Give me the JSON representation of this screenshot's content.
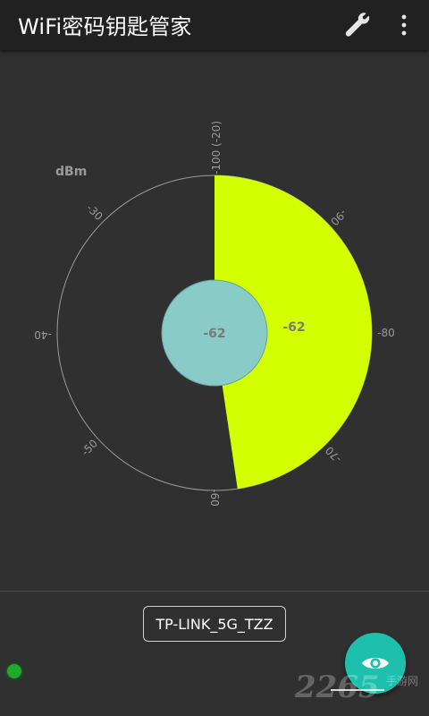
{
  "app": {
    "title": "WiFi密码钥匙管家"
  },
  "gauge": {
    "unit": "dBm",
    "ticks": [
      {
        "label": "-100 (-20)",
        "pos": "top"
      },
      {
        "label": "-90",
        "pos": "upper-right"
      },
      {
        "label": "-80",
        "pos": "right"
      },
      {
        "label": "-70",
        "pos": "lower-right"
      },
      {
        "label": "-60",
        "pos": "bottom"
      },
      {
        "label": "-50",
        "pos": "lower-left"
      },
      {
        "label": "-40",
        "pos": "left"
      },
      {
        "label": "-30",
        "pos": "upper-left"
      }
    ],
    "value": -62,
    "value_text": "-62",
    "fill_fraction": 0.4766,
    "colors": {
      "fill": "#d4ff00",
      "inner": "#88cbc7",
      "ring": "#9a9a9a",
      "text": "#7a7a7a"
    }
  },
  "network": {
    "ssid": "TP-LINK_5G_TZZ"
  },
  "status": {
    "color": "#1faa2b"
  },
  "fab": {
    "icon": "eye-icon",
    "color": "#1fbfae"
  },
  "watermark": {
    "text": "2265",
    "sub": "手游网"
  }
}
